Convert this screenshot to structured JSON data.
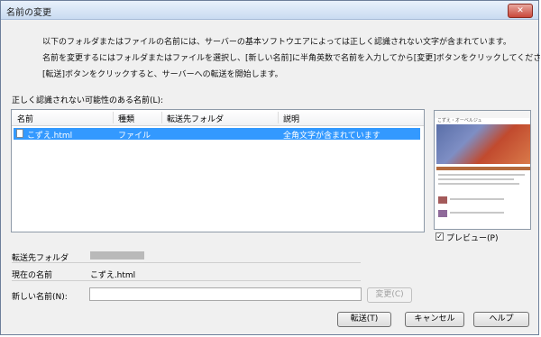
{
  "window": {
    "title": "名前の変更",
    "close_label": "✕"
  },
  "message": {
    "line1": "以下のフォルダまたはファイルの名前には、サーバーの基本ソフトウエアによっては正しく認識されない文字が含まれています。",
    "line2": "名前を変更するにはフォルダまたはファイルを選択し、[新しい名前]に半角英数で名前を入力してから[変更]ボタンをクリックしてください。",
    "line3": "[転送]ボタンをクリックすると、サーバーへの転送を開始します。"
  },
  "list": {
    "label": "正しく認識されない可能性のある名前(L):",
    "columns": [
      "名前",
      "種類",
      "転送先フォルダ",
      "説明"
    ],
    "rows": [
      {
        "name": "こずえ.html",
        "type": "ファイル",
        "folder": "",
        "description": "全角文字が含まれています"
      }
    ]
  },
  "preview": {
    "checkbox_label": "プレビュー(P)",
    "checked": true,
    "page_title": "こずえ・オーベルジュ"
  },
  "fields": {
    "dest_folder_label": "転送先フォルダ",
    "current_name_label": "現在の名前",
    "current_name_value": "こずえ.html",
    "new_name_label": "新しい名前(N):",
    "new_name_value": ""
  },
  "buttons": {
    "change": "変更(C)",
    "transfer": "転送(T)",
    "cancel": "キャンセル",
    "help": "ヘルプ"
  },
  "colors": {
    "selection": "#3399ff",
    "title_gradient_top": "#e9f1fb"
  }
}
